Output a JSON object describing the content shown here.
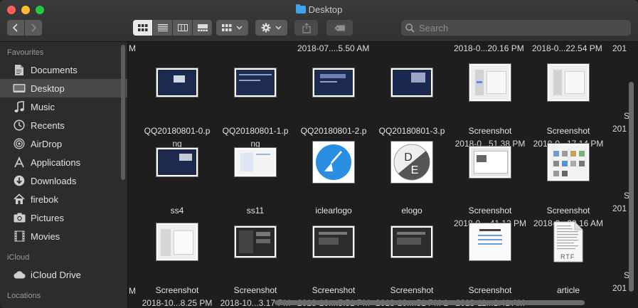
{
  "window": {
    "title": "Desktop"
  },
  "toolbar": {
    "search_placeholder": "Search",
    "back_icon": "chevron-left-icon",
    "forward_icon": "chevron-right-icon",
    "view_modes": [
      "icon",
      "list",
      "column",
      "gallery"
    ],
    "group_icon": "group-by-icon",
    "action_icon": "gear-icon",
    "share_icon": "share-icon",
    "tag_icon": "tag-icon"
  },
  "sidebar": {
    "favourites_label": "Favourites",
    "items": [
      {
        "label": "Documents",
        "icon": "document-icon",
        "selected": false
      },
      {
        "label": "Desktop",
        "icon": "desktop-icon",
        "selected": true
      },
      {
        "label": "Music",
        "icon": "music-note-icon",
        "selected": false
      },
      {
        "label": "Recents",
        "icon": "clock-icon",
        "selected": false
      },
      {
        "label": "AirDrop",
        "icon": "airdrop-icon",
        "selected": false
      },
      {
        "label": "Applications",
        "icon": "applications-icon",
        "selected": false
      },
      {
        "label": "Downloads",
        "icon": "download-icon",
        "selected": false
      },
      {
        "label": "firebok",
        "icon": "home-icon",
        "selected": false
      },
      {
        "label": "Pictures",
        "icon": "camera-icon",
        "selected": false
      },
      {
        "label": "Movies",
        "icon": "film-icon",
        "selected": false
      }
    ],
    "icloud_label": "iCloud",
    "icloud_items": [
      {
        "label": "iCloud Drive",
        "icon": "cloud-icon"
      }
    ],
    "locations_label": "Locations"
  },
  "content": {
    "top_row": [
      "M",
      "2018-07....5.50 AM",
      "2018-0...20.16 PM",
      "2018-0...22.54 PM",
      "201"
    ],
    "rows": [
      [
        {
          "line1": "QQ20180801-0.p",
          "line2": "ng",
          "thumb": "dark-screenshot"
        },
        {
          "line1": "QQ20180801-1.p",
          "line2": "ng",
          "thumb": "dark-screenshot"
        },
        {
          "line1": "QQ20180801-2.p",
          "line2": "ng",
          "thumb": "dark-screenshot"
        },
        {
          "line1": "QQ20180801-3.p",
          "line2": "ng",
          "thumb": "dark-screenshot"
        },
        {
          "line1": "Screenshot",
          "line2": "2018-0...51.38 PM",
          "thumb": "light-screenshot"
        },
        {
          "line1": "Screenshot",
          "line2": "2018-0...17.14 PM",
          "thumb": "light-screenshot"
        }
      ],
      [
        {
          "line1": "ss4",
          "line2": "",
          "thumb": "dark-screenshot"
        },
        {
          "line1": "ss11",
          "line2": "",
          "thumb": "light-screenshot"
        },
        {
          "line1": "iclearlogo",
          "line2": "",
          "thumb": "iclear-logo"
        },
        {
          "line1": "elogo",
          "line2": "",
          "thumb": "de-logo"
        },
        {
          "line1": "Screenshot",
          "line2": "2018-0....41.12 PM",
          "thumb": "light-screenshot"
        },
        {
          "line1": "Screenshot",
          "line2": "2018-0...29.16 AM",
          "thumb": "light-screenshot"
        }
      ],
      [
        {
          "line1": "Screenshot",
          "line2": "2018-10...8.25 PM",
          "thumb": "light-screenshot"
        },
        {
          "line1": "Screenshot",
          "line2": "2018-10...3.17 PM",
          "thumb": "dark-screenshot"
        },
        {
          "line1": "Screenshot",
          "line2": "2018-10....5.51 PM",
          "thumb": "dark-screenshot"
        },
        {
          "line1": "Screenshot",
          "line2": "2018-10....51 PM 1",
          "thumb": "dark-screenshot"
        },
        {
          "line1": "Screenshot",
          "line2": "2018-11...1.41 AM",
          "thumb": "light-screenshot"
        },
        {
          "line1": "article",
          "line2": "",
          "thumb": "rtf-document",
          "badge": "RTF"
        }
      ]
    ],
    "edge_left": [
      "M",
      "M",
      "M"
    ],
    "edge_right": [
      "S",
      "201",
      "S",
      "201",
      "S",
      "201"
    ],
    "logo_letters": [
      "D",
      "E"
    ]
  }
}
